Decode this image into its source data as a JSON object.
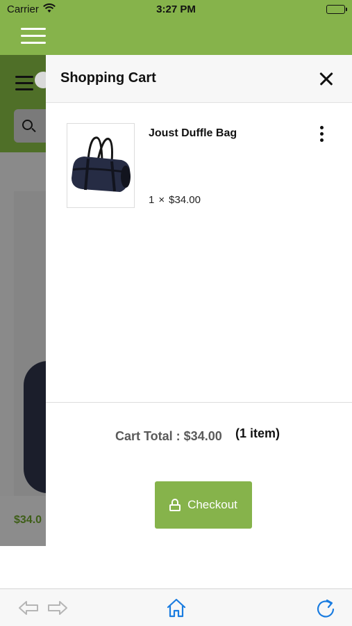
{
  "status_bar": {
    "carrier": "Carrier",
    "time": "3:27 PM",
    "battery_level": 1.0
  },
  "drawer": {
    "title": "Shopping Cart",
    "items": [
      {
        "name": "Joust Duffle Bag",
        "quantity": "1",
        "times_symbol": "×",
        "price": "$34.00"
      }
    ],
    "total_text": "Cart Total : $34.00",
    "item_count_text": "(1 item)",
    "checkout_label": "Checkout"
  },
  "background_page": {
    "price": "$34.0"
  },
  "colors": {
    "brand_green": "#86b34b",
    "dark_green": "#4f6f28",
    "toolbar_blue": "#1a7ce0",
    "toolbar_disabled": "#b5b5b5"
  },
  "icons": {
    "header_menu": "hamburger-icon",
    "close": "close-icon",
    "item_menu": "more-vertical-icon",
    "checkout": "lock-icon",
    "toolbar": [
      "back-arrow-icon",
      "forward-arrow-icon",
      "home-icon",
      "reload-icon"
    ]
  }
}
